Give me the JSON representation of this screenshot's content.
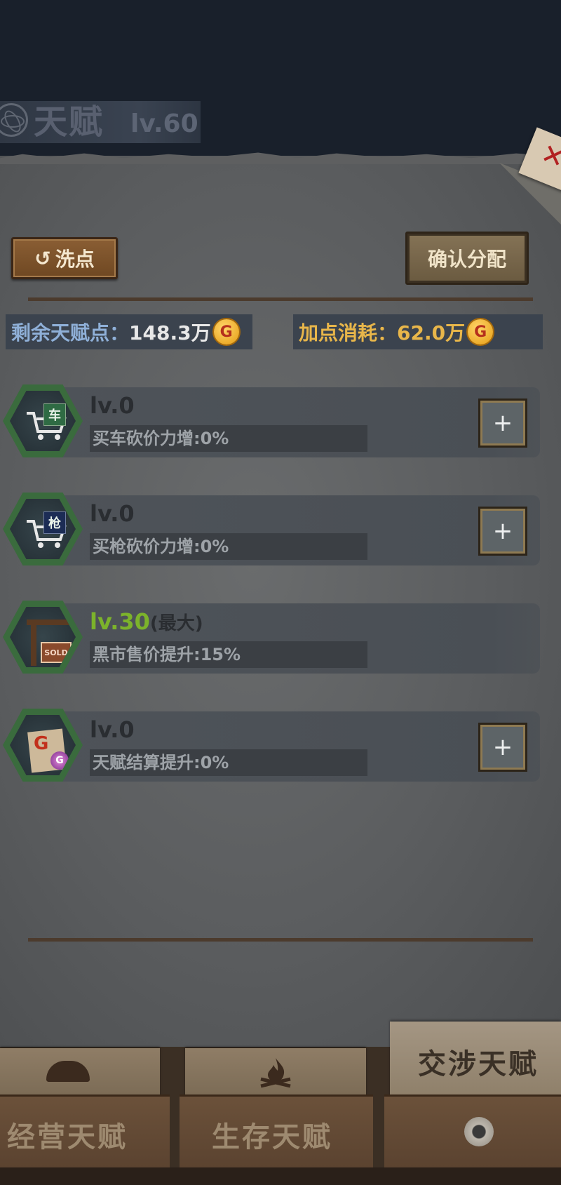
{
  "header": {
    "title": "天赋",
    "level": "lv.60"
  },
  "actions": {
    "reset_label": "洗点",
    "confirm_label": "确认分配"
  },
  "stats": {
    "remaining_label": "剩余天赋点：",
    "remaining_value": "148.3万",
    "cost_label": "加点消耗：",
    "cost_value": "62.0万",
    "coin_symbol": "G"
  },
  "talents": [
    {
      "icon": "cart-car-icon",
      "tag": "车",
      "level": "lv.0",
      "desc": "买车砍价力增:0%",
      "plus": "+"
    },
    {
      "icon": "cart-gun-icon",
      "tag": "枪",
      "level": "lv.0",
      "desc": "买枪砍价力增:0%",
      "plus": "+"
    },
    {
      "icon": "sold-sign-icon",
      "tag": "SOLD",
      "level": "lv.30",
      "max_tag": "(最大)",
      "desc": "黑市售价提升:15%"
    },
    {
      "icon": "coin-paper-icon",
      "tag": "G",
      "level": "lv.0",
      "desc": "天赋结算提升:0%",
      "plus": "+"
    }
  ],
  "tabs": {
    "operate": "经营天赋",
    "survive": "生存天赋",
    "negotiate": "交涉天赋"
  },
  "colors": {
    "label_blue": "#8fb0d8",
    "value_white": "#e8e8e8",
    "label_gold": "#e8b64a",
    "max_green": "#7cb32b"
  }
}
